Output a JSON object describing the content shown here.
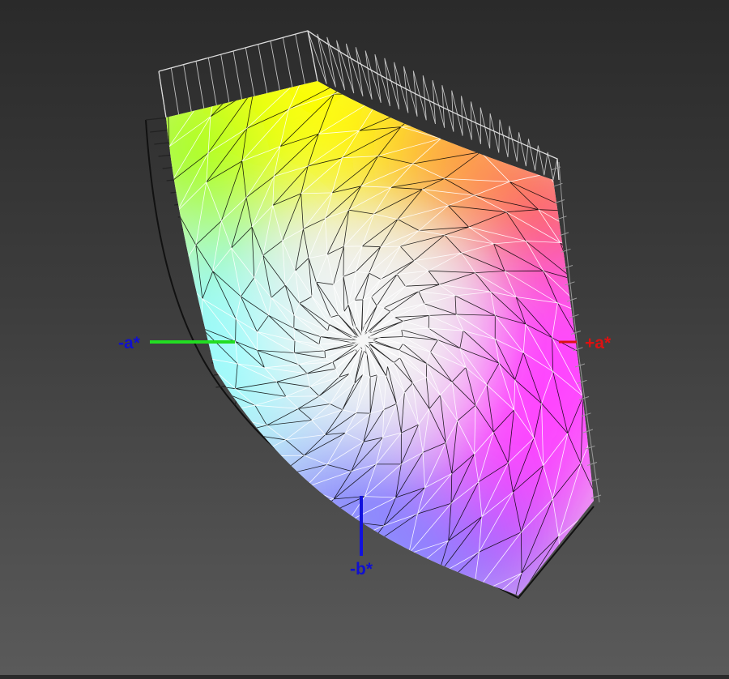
{
  "axes": {
    "neg_a": {
      "label": "-a*",
      "label_color": "#1010d0",
      "line_color": "#22dd22"
    },
    "pos_a": {
      "label": "+a*",
      "label_color": "#dd1111",
      "line_color": "#dd1111"
    },
    "neg_b": {
      "label": "-b*",
      "label_color": "#1010d0",
      "line_color": "#1111dd"
    }
  },
  "colors": {
    "background_top": "#2a2a2a",
    "background_bottom": "#5a5a5a",
    "gamut_yellow": "#ffff00",
    "gamut_green": "#a0ff20",
    "gamut_cyan": "#80ffff",
    "gamut_blue": "#8080ff",
    "gamut_purple": "#b040ff",
    "gamut_magenta": "#ff40ff",
    "gamut_red": "#ff5050",
    "gamut_orange": "#ff9a30",
    "gamut_center": "#f4f4f4",
    "wire_dark": "#000000",
    "wire_light": "#ffffff",
    "outer_wire": "#dddddd"
  }
}
